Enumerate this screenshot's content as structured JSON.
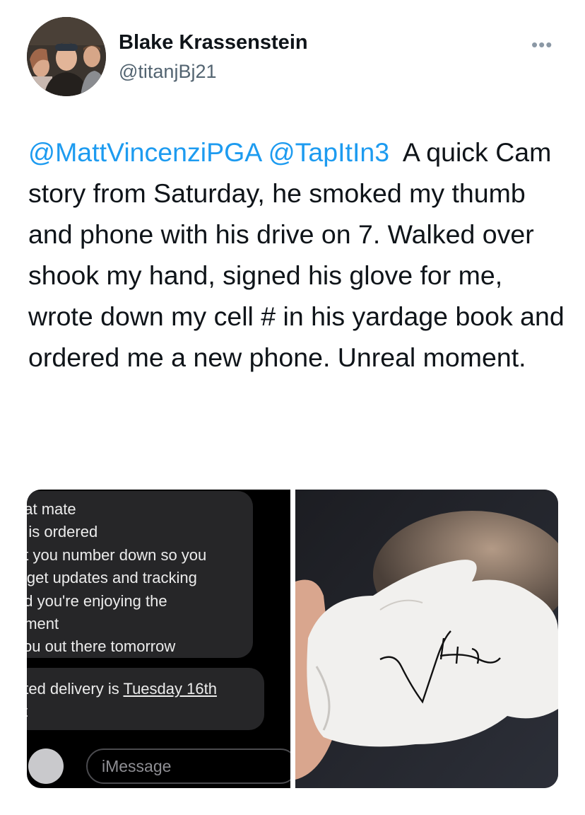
{
  "author": {
    "name": "Blake Krassenstein",
    "handle": "@titanjBj21"
  },
  "tweet": {
    "mention1": "@MattVincenziPGA",
    "mention2": "@TapItIn3",
    "body": "A quick Cam story from Saturday, he smoked my thumb and phone with his drive on 7. Walked over shook my hand, signed his glove for me, wrote down my cell # in his yardage book and ordered me a new phone. Unreal moment."
  },
  "menu": {
    "more_label": "•••"
  },
  "media": {
    "messages": {
      "bubble1_lines": [
        "eat mate",
        "e is ordered",
        "ot you number down so you",
        "ll get updates and tracking",
        "nd you're enjoying the",
        "oment",
        "you out there tomorrow"
      ],
      "bubble2_prefix": "ated delivery is ",
      "bubble2_date": "Tuesday 16th",
      "bubble2_line2": "st"
    },
    "compose": {
      "appstore_icon": "A",
      "placeholder": "iMessage"
    }
  },
  "colors": {
    "link": "#1d9bf0",
    "secondary_text": "#536471",
    "bubble": "#262628"
  }
}
